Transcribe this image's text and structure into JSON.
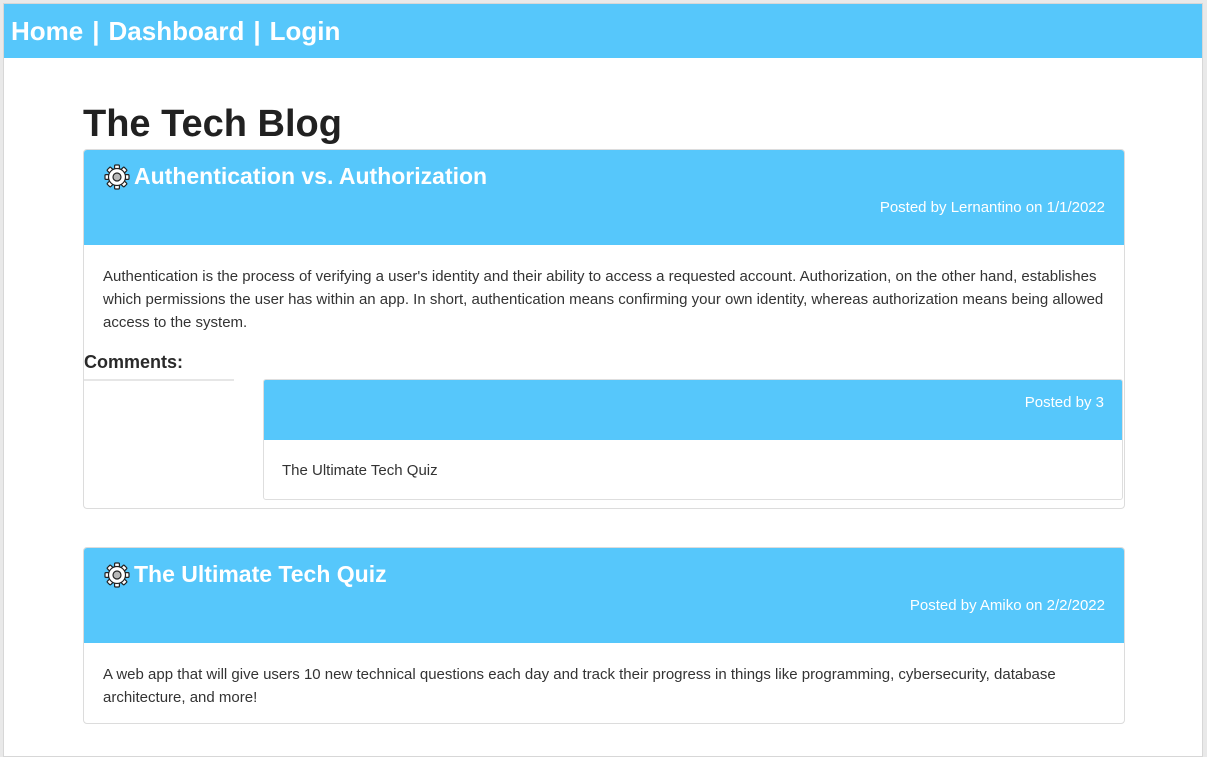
{
  "nav": {
    "home": "Home",
    "separator": "|",
    "dashboard": "Dashboard",
    "login": "Login"
  },
  "page": {
    "title": "The Tech Blog"
  },
  "posts": [
    {
      "icon": "gear-icon",
      "title": "Authentication vs. Authorization",
      "meta": "Posted by Lernantino on 1/1/2022",
      "body": "Authentication is the process of verifying a user's identity and their ability to access a requested account. Authorization, on the other hand, establishes which permissions the user has within an app. In short, authentication means confirming your own identity, whereas authorization means being allowed access to the system.",
      "comments_label": "Comments:",
      "comments": [
        {
          "meta": "Posted by 3",
          "body": "The Ultimate Tech Quiz"
        }
      ]
    },
    {
      "icon": "gear-icon",
      "title": "The Ultimate Tech Quiz",
      "meta": "Posted by Amiko on 2/2/2022",
      "body": "A web app that will give users 10 new technical questions each day and track their progress in things like programming, cybersecurity, database architecture, and more!"
    }
  ],
  "colors": {
    "accent": "#56c7fb",
    "text": "#333333",
    "heading": "#212121"
  }
}
